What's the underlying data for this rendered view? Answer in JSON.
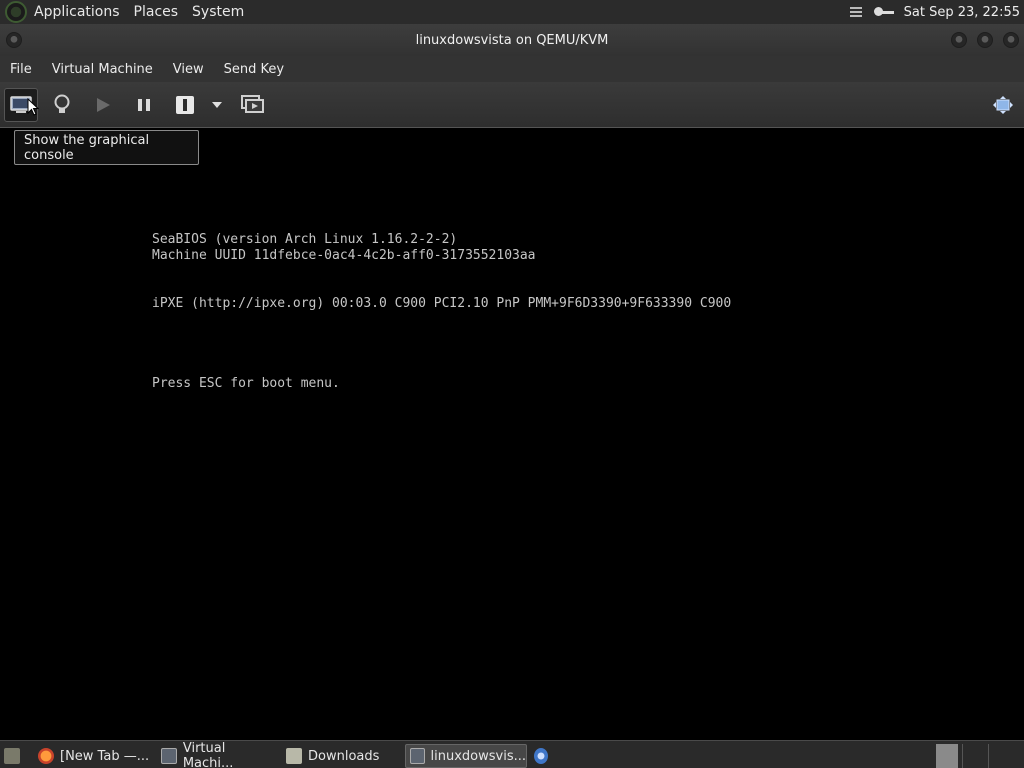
{
  "top_panel": {
    "menus": [
      "Applications",
      "Places",
      "System"
    ],
    "clock": "Sat Sep 23, 22:55"
  },
  "window": {
    "title": "linuxdowsvista on QEMU/KVM"
  },
  "menubar": {
    "items": [
      "File",
      "Virtual Machine",
      "View",
      "Send Key"
    ]
  },
  "toolbar": {
    "tooltip": "Show the graphical console",
    "buttons": [
      "console-icon",
      "lightbulb-icon",
      "play-icon",
      "pause-icon",
      "power-icon",
      "dropdown-arrow-icon",
      "snapshots-icon",
      "fullscreen-icon"
    ]
  },
  "console": {
    "lines": [
      "SeaBIOS (version Arch Linux 1.16.2-2-2)",
      "Machine UUID 11dfebce-0ac4-4c2b-aff0-3173552103aa",
      "iPXE (http://ipxe.org) 00:03.0 C900 PCI2.10 PnP PMM+9F6D3390+9F633390 C900",
      "Press ESC for boot menu."
    ]
  },
  "taskbar": {
    "tasks": [
      "[New Tab —...",
      "Virtual Machi...",
      "Downloads",
      "linuxdowsvis..."
    ]
  },
  "colors": {
    "panel": "#2b2b2b",
    "console_bg": "#000000",
    "console_text": "#c6c6c6",
    "accent_green": "#3e5b32"
  }
}
